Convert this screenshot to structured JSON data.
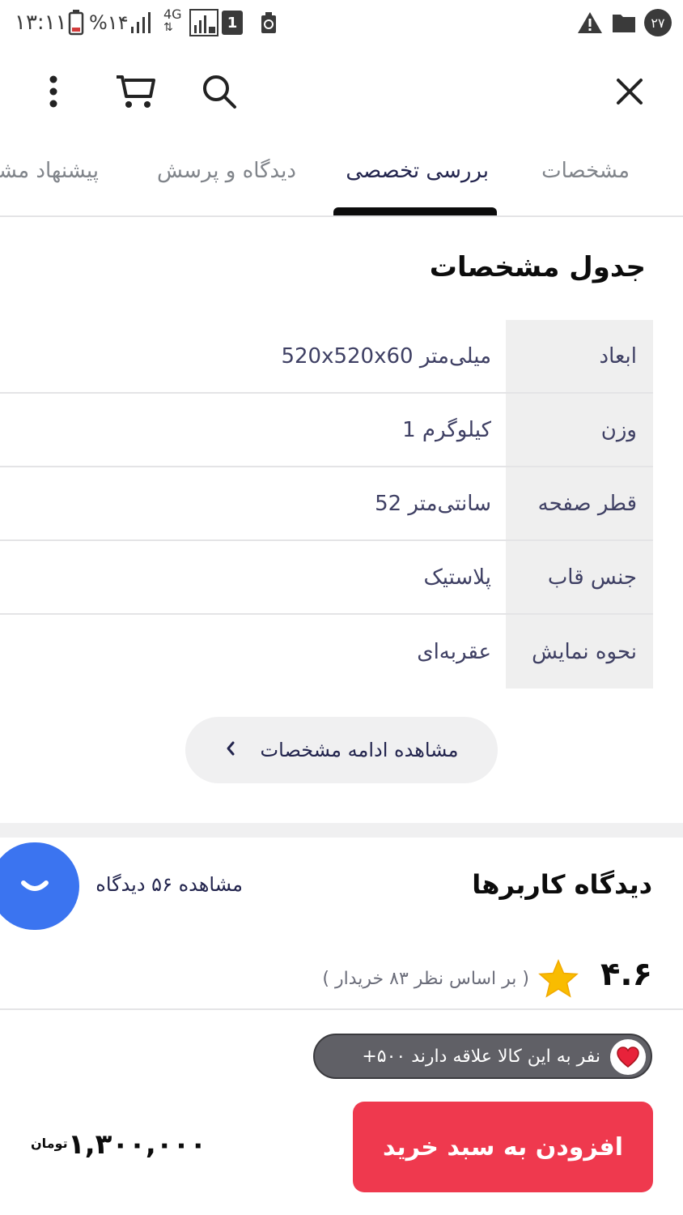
{
  "status_bar": {
    "time": "۱۳:۱۱",
    "battery_percent": "%۱۴",
    "network": "4G",
    "sim_badge": "1",
    "notification_count": "۲۷"
  },
  "toolbar": {
    "icons": [
      "close-icon",
      "search-icon",
      "cart-icon",
      "more-vertical-icon"
    ]
  },
  "tabs": [
    {
      "label": "مشخصات",
      "active": false
    },
    {
      "label": "بررسی تخصصی",
      "active": true
    },
    {
      "label": "دیدگاه و پرسش",
      "active": false
    },
    {
      "label": "پیشنهاد مشابه",
      "active": false
    }
  ],
  "specs": {
    "title": "جدول مشخصات",
    "rows": [
      {
        "key": "ابعاد",
        "value": "520x520x60 میلی‌متر"
      },
      {
        "key": "وزن",
        "value": "1 کیلوگرم"
      },
      {
        "key": "قطر صفحه",
        "value": "52 سانتی‌متر"
      },
      {
        "key": "جنس قاب",
        "value": "پلاستیک"
      },
      {
        "key": "نحوه نمایش",
        "value": "عقربه‌ای"
      }
    ],
    "more_label": "مشاهده ادامه مشخصات"
  },
  "reviews": {
    "title": "دیدگاه کاربرها",
    "view_link": "مشاهده ۵۶ دیدگاه",
    "rating": "۴.۶",
    "rating_caption": "( بر اساس نظر ۸۳ خریدار )"
  },
  "purchase": {
    "interest_text": "+۵۰۰ نفر به این کالا علاقه دارند",
    "add_to_cart_label": "افزودن به سبد خرید",
    "price": "۱,۳۰۰,۰۰۰",
    "currency": "تومان"
  },
  "colors": {
    "accent_red": "#ef394e",
    "chat_blue": "#3b74f0",
    "text_dark": "#0c0c0c",
    "star_yellow": "#f9bc00"
  }
}
